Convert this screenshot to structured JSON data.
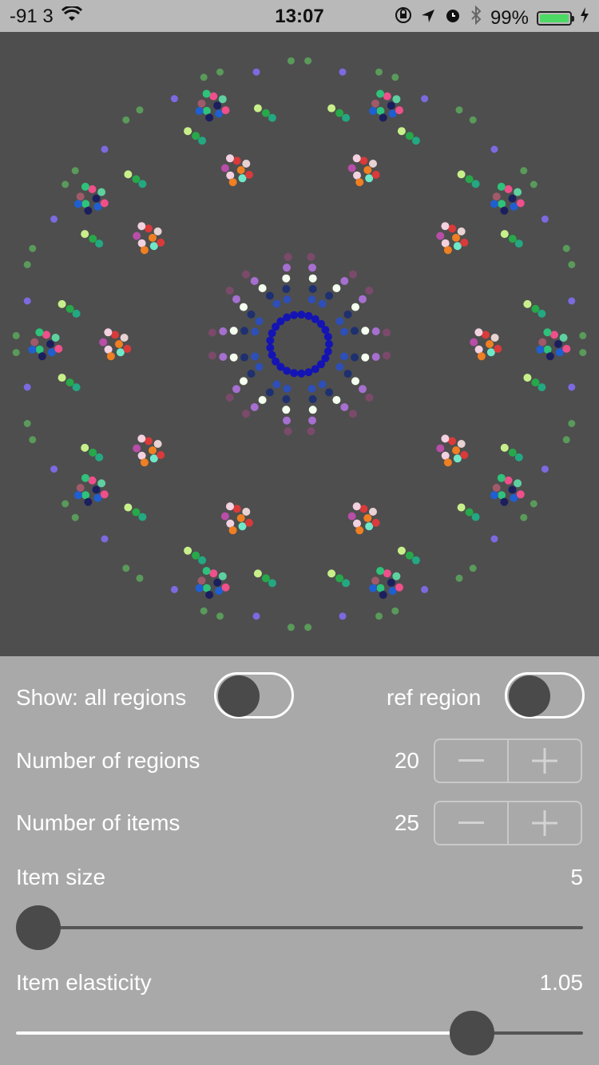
{
  "status": {
    "signal": "-91 3",
    "time": "13:07",
    "battery": "99%",
    "battery_level": 0.99
  },
  "controls": {
    "show_label": "Show: all regions",
    "show_toggle": false,
    "ref_label": "ref region",
    "ref_toggle": false,
    "regions_label": "Number of regions",
    "regions_value": "20",
    "items_label": "Number of items",
    "items_value": "25",
    "size_label": "Item size",
    "size_value": "5",
    "size_slider_fraction": 0.0,
    "elasticity_label": "Item elasticity",
    "elasticity_value": "1.05",
    "elasticity_slider_fraction": 0.83
  },
  "colors": {
    "canvas_bg": "#4e4e4e",
    "panel_bg": "#a9a9a9",
    "center_ring": "#1414b4"
  }
}
